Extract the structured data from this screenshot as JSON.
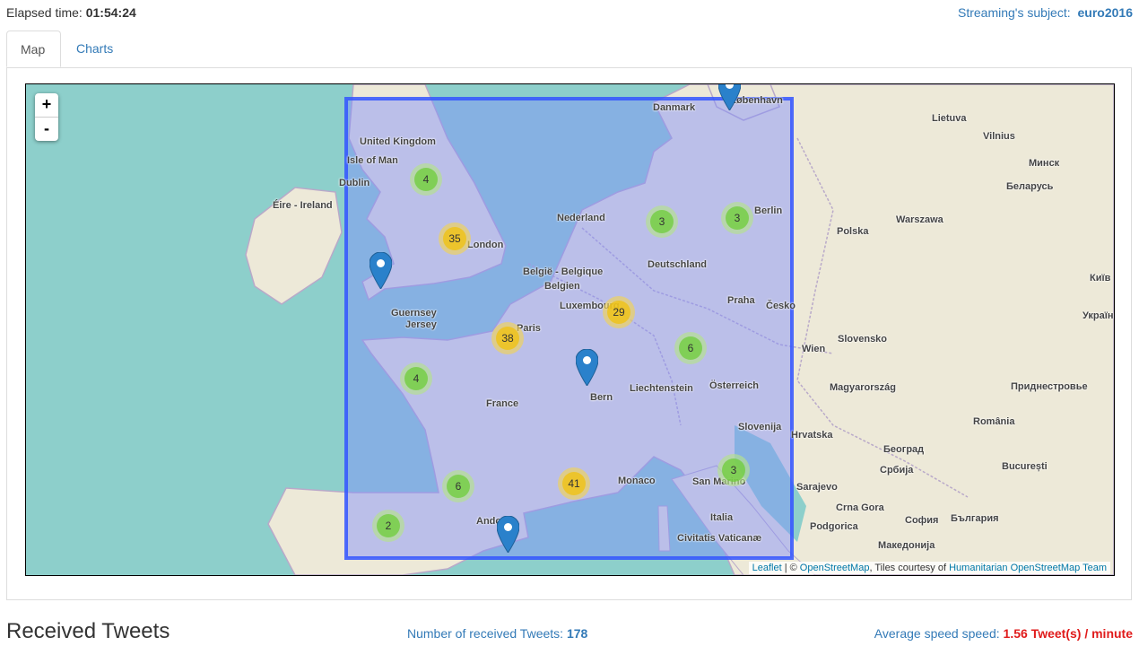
{
  "header": {
    "elapsed_label": "Elapsed time:",
    "elapsed_value": "01:54:24",
    "subject_label": "Streaming's subject:",
    "subject_value": "euro2016"
  },
  "tabs": [
    {
      "label": "Map",
      "active": true
    },
    {
      "label": "Charts",
      "active": false
    }
  ],
  "map": {
    "zoom_in": "+",
    "zoom_out": "-",
    "clusters": [
      {
        "count": "4",
        "level": "green"
      },
      {
        "count": "35",
        "level": "yellow"
      },
      {
        "count": "3",
        "level": "green"
      },
      {
        "count": "3",
        "level": "green"
      },
      {
        "count": "29",
        "level": "yellow"
      },
      {
        "count": "38",
        "level": "yellow"
      },
      {
        "count": "6",
        "level": "green"
      },
      {
        "count": "4",
        "level": "green"
      },
      {
        "count": "3",
        "level": "green"
      },
      {
        "count": "6",
        "level": "green"
      },
      {
        "count": "41",
        "level": "yellow"
      },
      {
        "count": "2",
        "level": "green"
      }
    ],
    "labels": {
      "united_kingdom": "United Kingdom",
      "isle_of_man": "Isle of Man",
      "dublin": "Dublin",
      "eire": "Éire - Ireland",
      "london": "London",
      "nederland": "Nederland",
      "belgie": "België - Belgique",
      "belgien": "Belgien",
      "luxembourg": "Luxembourg",
      "deutschland": "Deutschland",
      "berlin": "Berlin",
      "danmark": "Danmark",
      "kobenhavn": "København",
      "guernsey": "Guernsey",
      "jersey": "Jersey",
      "paris": "Paris",
      "france": "France",
      "bern": "Bern",
      "liechtenstein": "Liechtenstein",
      "osterreich": "Österreich",
      "praha": "Praha",
      "cesko": "Česko",
      "wien": "Wien",
      "slovensko": "Slovensko",
      "magyarorszag": "Magyarország",
      "slovenija": "Slovenija",
      "hrvatska": "Hrvatska",
      "monaco": "Monaco",
      "san_marino": "San Marino",
      "italia": "Italia",
      "vaticano": "Civitatis Vaticanæ",
      "andorra": "Andorra",
      "polska": "Polska",
      "warszawa": "Warszawa",
      "lietuva": "Lietuva",
      "vilnius": "Vilnius",
      "minsk": "Минск",
      "belarus": "Беларусь",
      "kyiv": "Київ",
      "ukraine": "Україн",
      "romania": "România",
      "bucuresti": "București",
      "beograd": "Београд",
      "srbija": "Србија",
      "sarajevo": "Sarajevo",
      "crna_gora": "Crna Gora",
      "podgorica": "Podgorica",
      "sofia": "София",
      "bulgaria": "България",
      "makedonija": "Македонија",
      "pridnestrovie": "Приднестровье"
    },
    "attribution": {
      "leaflet": "Leaflet",
      "sep": " | © ",
      "osm": "OpenStreetMap",
      "tiles": ", Tiles courtesy of ",
      "hot": "Humanitarian OpenStreetMap Team"
    },
    "colors": {
      "sea": "#8dcfcb",
      "land": "#ede9d8",
      "bbox_fill": "#7f8cff",
      "bbox_stroke": "#3355ff",
      "marker": "#2a81cb"
    }
  },
  "footer": {
    "title": "Received Tweets",
    "count_label": "Number of received Tweets:",
    "count_value": "178",
    "speed_label": "Average speed speed:",
    "speed_value": "1.56 Tweet(s) / minute"
  }
}
